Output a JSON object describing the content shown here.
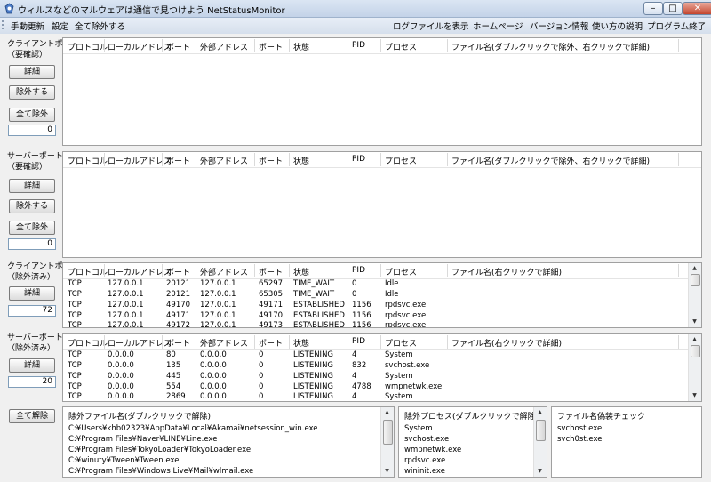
{
  "window": {
    "title": "ウィルスなどのマルウェアは通信で見つけよう NetStatusMonitor"
  },
  "titlebar_buttons": {
    "minimize": "–",
    "maximize": "□",
    "close": "✕"
  },
  "menu": {
    "left": [
      "手動更新",
      "設定",
      "全て除外する"
    ],
    "right": [
      "ログファイルを表示",
      "ホームページ",
      "バージョン情報",
      "使い方の説明",
      "プログラム終了"
    ]
  },
  "columns": [
    "プロトコル",
    "ローカルアドレス",
    "ポート",
    "外部アドレス",
    "ポート",
    "状態",
    "PID",
    "プロセス"
  ],
  "filename_col_confirm": "ファイル名(ダブルクリックで除外、右クリックで詳細)",
  "filename_col_excluded": "ファイル名(右クリックで詳細)",
  "sections": {
    "client_confirm": {
      "label_line1": "クライアントポート",
      "label_line2": "（要確認）",
      "detail_button": "詳細",
      "exclude_button": "除外する",
      "exclude_all_button": "全て除外",
      "count": "0"
    },
    "server_confirm": {
      "label_line1": "サーバーポート",
      "label_line2": "（要確認）",
      "detail_button": "詳細",
      "exclude_button": "除外する",
      "exclude_all_button": "全て除外",
      "count": "0"
    },
    "client_excluded": {
      "label_line1": "クライアントポート",
      "label_line2": "（除外済み）",
      "detail_button": "詳細",
      "count": "72",
      "rows": [
        [
          "TCP",
          "127.0.0.1",
          "20121",
          "127.0.0.1",
          "65297",
          "TIME_WAIT",
          "0",
          "Idle"
        ],
        [
          "TCP",
          "127.0.0.1",
          "20121",
          "127.0.0.1",
          "65305",
          "TIME_WAIT",
          "0",
          "Idle"
        ],
        [
          "TCP",
          "127.0.0.1",
          "49170",
          "127.0.0.1",
          "49171",
          "ESTABLISHED",
          "1156",
          "rpdsvc.exe"
        ],
        [
          "TCP",
          "127.0.0.1",
          "49171",
          "127.0.0.1",
          "49170",
          "ESTABLISHED",
          "1156",
          "rpdsvc.exe"
        ],
        [
          "TCP",
          "127.0.0.1",
          "49172",
          "127.0.0.1",
          "49173",
          "ESTABLISHED",
          "1156",
          "rpdsvc.exe"
        ]
      ]
    },
    "server_excluded": {
      "label_line1": "サーバーポート",
      "label_line2": "（除外済み）",
      "detail_button": "詳細",
      "count": "20",
      "rows": [
        [
          "TCP",
          "0.0.0.0",
          "80",
          "0.0.0.0",
          "0",
          "LISTENING",
          "4",
          "System"
        ],
        [
          "TCP",
          "0.0.0.0",
          "135",
          "0.0.0.0",
          "0",
          "LISTENING",
          "832",
          "svchost.exe"
        ],
        [
          "TCP",
          "0.0.0.0",
          "445",
          "0.0.0.0",
          "0",
          "LISTENING",
          "4",
          "System"
        ],
        [
          "TCP",
          "0.0.0.0",
          "554",
          "0.0.0.0",
          "0",
          "LISTENING",
          "4788",
          "wmpnetwk.exe"
        ],
        [
          "TCP",
          "0.0.0.0",
          "2869",
          "0.0.0.0",
          "0",
          "LISTENING",
          "4",
          "System"
        ]
      ]
    }
  },
  "bottom": {
    "clear_all_button": "全て解除",
    "excluded_files": {
      "header": "除外ファイル名(ダブルクリックで解除)",
      "items": [
        "C:¥Users¥khb02323¥AppData¥Local¥Akamai¥netsession_win.exe",
        "C:¥Program Files¥Naver¥LINE¥Line.exe",
        "C:¥Program Files¥TokyoLoader¥TokyoLoader.exe",
        "C:¥winuty¥Tween¥Tween.exe",
        "C:¥Program Files¥Windows Live¥Mail¥wlmail.exe"
      ]
    },
    "excluded_processes": {
      "header": "除外プロセス(ダブルクリックで解除)",
      "items": [
        "System",
        "svchost.exe",
        "wmpnetwk.exe",
        "rpdsvc.exe",
        "wininit.exe"
      ]
    },
    "spoof_check": {
      "header": "ファイル名偽装チェック",
      "items": [
        "svchost.exe",
        "svch0st.exe"
      ]
    }
  }
}
